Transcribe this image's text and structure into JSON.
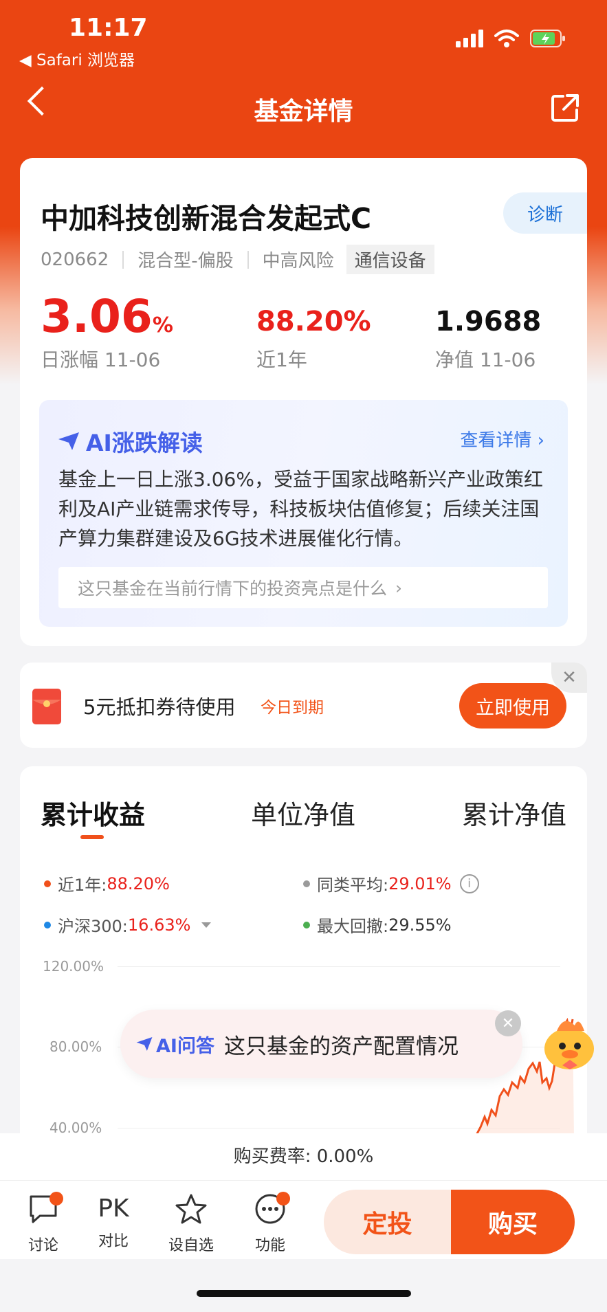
{
  "status_bar": {
    "time": "11:17",
    "back_app": "◀ Safari 浏览器"
  },
  "nav": {
    "title": "基金详情"
  },
  "fund": {
    "name": "中加科技创新混合发起式C",
    "diagnose_label": "诊断",
    "code": "020662",
    "type": "混合型-偏股",
    "risk": "中高风险",
    "sector_tag": "通信设备",
    "daily_change_value": "3.06",
    "daily_change_unit": "%",
    "daily_change_label": "日涨幅 11-06",
    "one_year_value": "88.20%",
    "one_year_label": "近1年",
    "nav_value": "1.9688",
    "nav_label": "净值 11-06"
  },
  "ai_analysis": {
    "title": "AI涨跌解读",
    "more_label": "查看详情",
    "body": "基金上一日上涨3.06%，受益于国家战略新兴产业政策红利及AI产业链需求传导，科技板块估值修复；后续关注国产算力集群建设及6G技术进展催化行情。",
    "question": "这只基金在当前行情下的投资亮点是什么"
  },
  "coupon": {
    "text": "5元抵扣券待使用",
    "expiry": "今日到期",
    "use_label": "立即使用",
    "close": "✕"
  },
  "chart_section": {
    "tabs": [
      "累计收益",
      "单位净值",
      "累计净值"
    ],
    "legend": {
      "fund_label": "近1年:",
      "fund_value": "88.20%",
      "peer_label": "同类平均:",
      "peer_value": "29.01%",
      "index_label": "沪深300:",
      "index_value": "16.63%",
      "drawdown_label": "最大回撤:",
      "drawdown_value": "29.55%"
    },
    "y_ticks": [
      "120.00%",
      "80.00%",
      "40.00%"
    ],
    "colors": {
      "fund": "#f0501b",
      "peer": "#9a9a9a",
      "index": "#1e88e5",
      "drawdown": "#4caf50"
    }
  },
  "ai_bubble": {
    "prefix": "AI问答",
    "text": "这只基金的资产配置情况",
    "close": "✕"
  },
  "fee": {
    "text": "购买费率: 0.00%"
  },
  "bottom_bar": {
    "discuss": "讨论",
    "compare_icon_text": "PK",
    "compare": "对比",
    "watchlist": "设自选",
    "functions": "功能",
    "auto_invest": "定投",
    "buy": "购买"
  }
}
